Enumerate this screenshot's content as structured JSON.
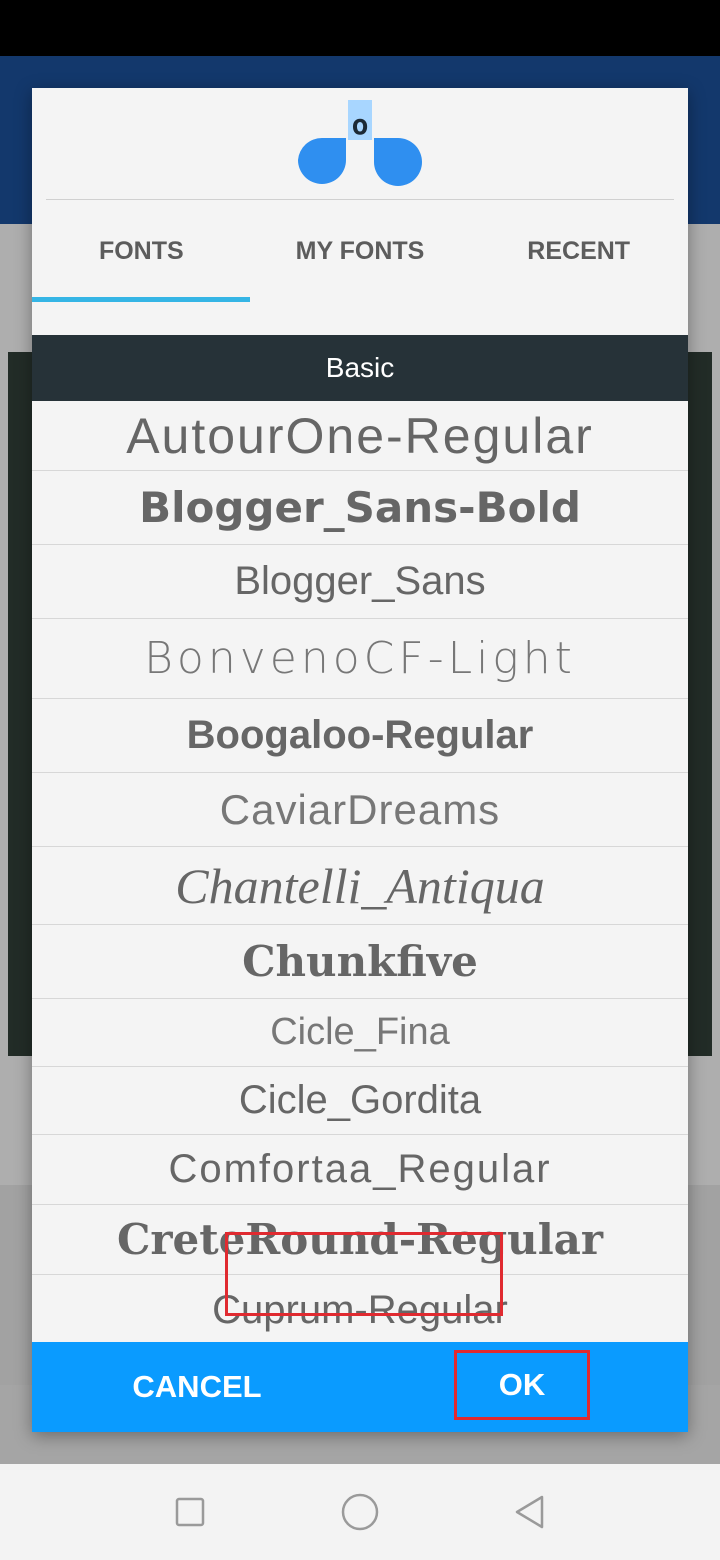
{
  "dialog": {
    "logo_icon": "font-app-logo-icon",
    "tabs": [
      {
        "label": "FONTS",
        "active": true
      },
      {
        "label": "MY FONTS",
        "active": false
      },
      {
        "label": "RECENT",
        "active": false
      }
    ],
    "section_title": "Basic",
    "fonts": [
      "AutourOne-Regular",
      "Blogger_Sans-Bold",
      "Blogger_Sans",
      "BonvenoCF-Light",
      "Boogaloo-Regular",
      "CaviarDreams",
      "Chantelli_Antiqua",
      "Chunkfive",
      "Cicle_Fina",
      "Cicle_Gordita",
      "Comfortaa_Regular",
      "CreteRound-Regular",
      "Cuprum-Regular"
    ],
    "highlighted_font": "Chunkfive",
    "cancel_label": "CANCEL",
    "ok_label": "OK"
  },
  "navigation": {
    "icons": [
      "recent-apps-icon",
      "home-icon",
      "back-icon"
    ]
  },
  "colors": {
    "accent": "#35b5e5",
    "button_bar": "#0a9bff",
    "section_header": "#263238",
    "highlight": "#e02a30"
  }
}
